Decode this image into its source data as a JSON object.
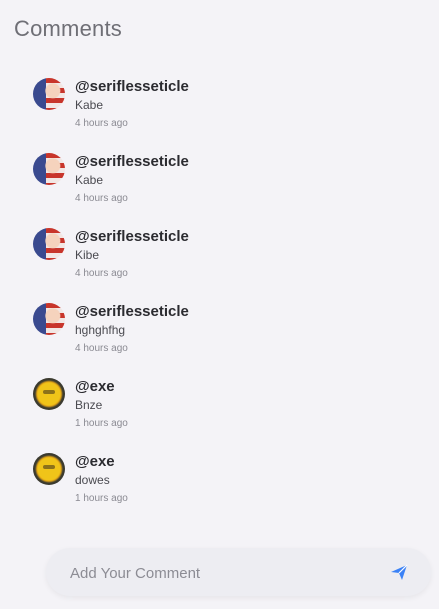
{
  "page": {
    "title": "Comments"
  },
  "comments": [
    {
      "username": "@seriflesseticle",
      "text": "Kabe",
      "time": "4 hours ago",
      "avatar": "flag-avatar"
    },
    {
      "username": "@seriflesseticle",
      "text": "Kabe",
      "time": "4 hours ago",
      "avatar": "flag-avatar"
    },
    {
      "username": "@seriflesseticle",
      "text": "Kibe",
      "time": "4 hours ago",
      "avatar": "flag-avatar"
    },
    {
      "username": "@seriflesseticle",
      "text": "hghghfhg",
      "time": "4 hours ago",
      "avatar": "flag-avatar"
    },
    {
      "username": "@exe",
      "text": "Bnze",
      "time": "1 hours ago",
      "avatar": "emoji-avatar"
    },
    {
      "username": "@exe",
      "text": "dowes",
      "time": "1 hours ago",
      "avatar": "emoji-avatar"
    }
  ],
  "composer": {
    "placeholder": "Add Your Comment",
    "send_icon": "send-icon",
    "accent": "#3b82f6"
  }
}
